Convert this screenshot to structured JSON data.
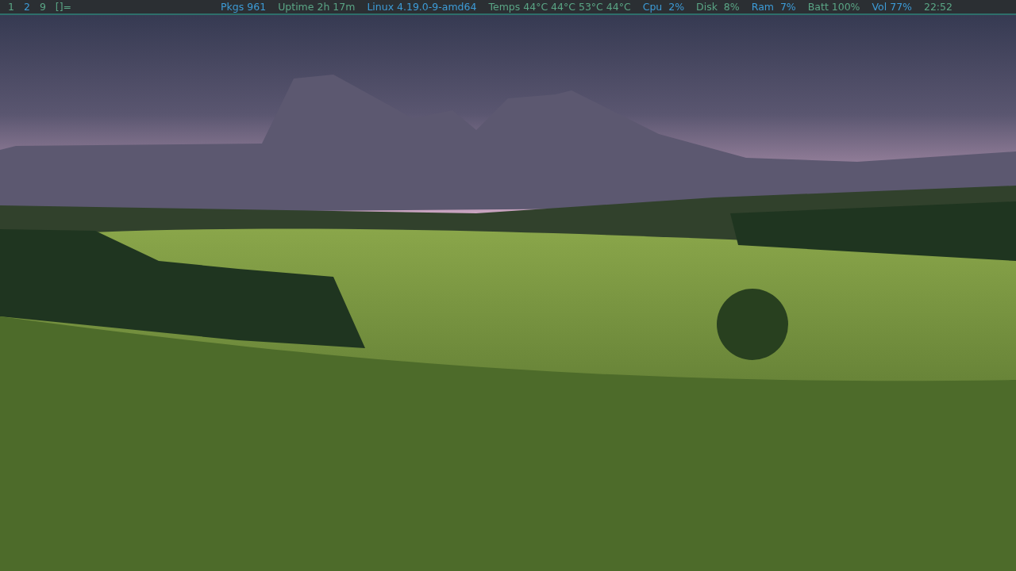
{
  "bar": {
    "tags": [
      {
        "label": "1",
        "selected": false
      },
      {
        "label": "2",
        "selected": true
      },
      {
        "label": "9",
        "selected": false
      }
    ],
    "layout": "[]=",
    "status": [
      {
        "text": "Pkgs 961",
        "color": "#3d9bd6"
      },
      {
        "text": "Uptime 2h 17m",
        "color": "#5aa585"
      },
      {
        "text": "Linux 4.19.0-9-amd64",
        "color": "#3d9bd6"
      },
      {
        "text": "Temps 44°C 44°C 53°C 44°C",
        "color": "#5aa585"
      },
      {
        "text": "Cpu  2%",
        "color": "#3d9bd6"
      },
      {
        "text": "Disk  8%",
        "color": "#5aa585"
      },
      {
        "text": "Ram  7%",
        "color": "#3d9bd6"
      },
      {
        "text": "Batt 100%",
        "color": "#5aa585"
      },
      {
        "text": "Vol 77%",
        "color": "#3d9bd6"
      },
      {
        "text": "22:52",
        "color": "#5aa585"
      }
    ]
  }
}
